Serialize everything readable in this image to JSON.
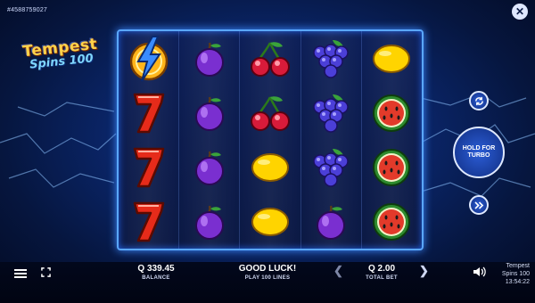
{
  "header": {
    "id_text": "#4588759027",
    "close_label": "✕"
  },
  "logo": {
    "line1": "Tempest",
    "line2": "Spins 100"
  },
  "reels": [
    [
      "bolt",
      "seven",
      "seven",
      "seven"
    ],
    [
      "plum",
      "plum",
      "plum",
      "plum"
    ],
    [
      "cherry",
      "cherry",
      "lemon",
      "lemon"
    ],
    [
      "grapes",
      "grapes",
      "grapes",
      "plum"
    ],
    [
      "lemon",
      "watermelon",
      "watermelon",
      "watermelon"
    ]
  ],
  "controls": {
    "turbo_line1": "HOLD FOR",
    "turbo_line2": "TURBO"
  },
  "footer": {
    "balance_value": "Q 339.45",
    "balance_label": "BALANCE",
    "message": "GOOD LUCK!",
    "message_sub": "PLAY 100 LINES",
    "bet_value": "Q 2.00",
    "bet_label": "TOTAL BET",
    "game_line1": "Tempest",
    "game_line2": "Spins 100",
    "clock": "13:54:22"
  },
  "colors": {
    "background": "#0b2870",
    "reel_border": "#5aa7ff"
  }
}
